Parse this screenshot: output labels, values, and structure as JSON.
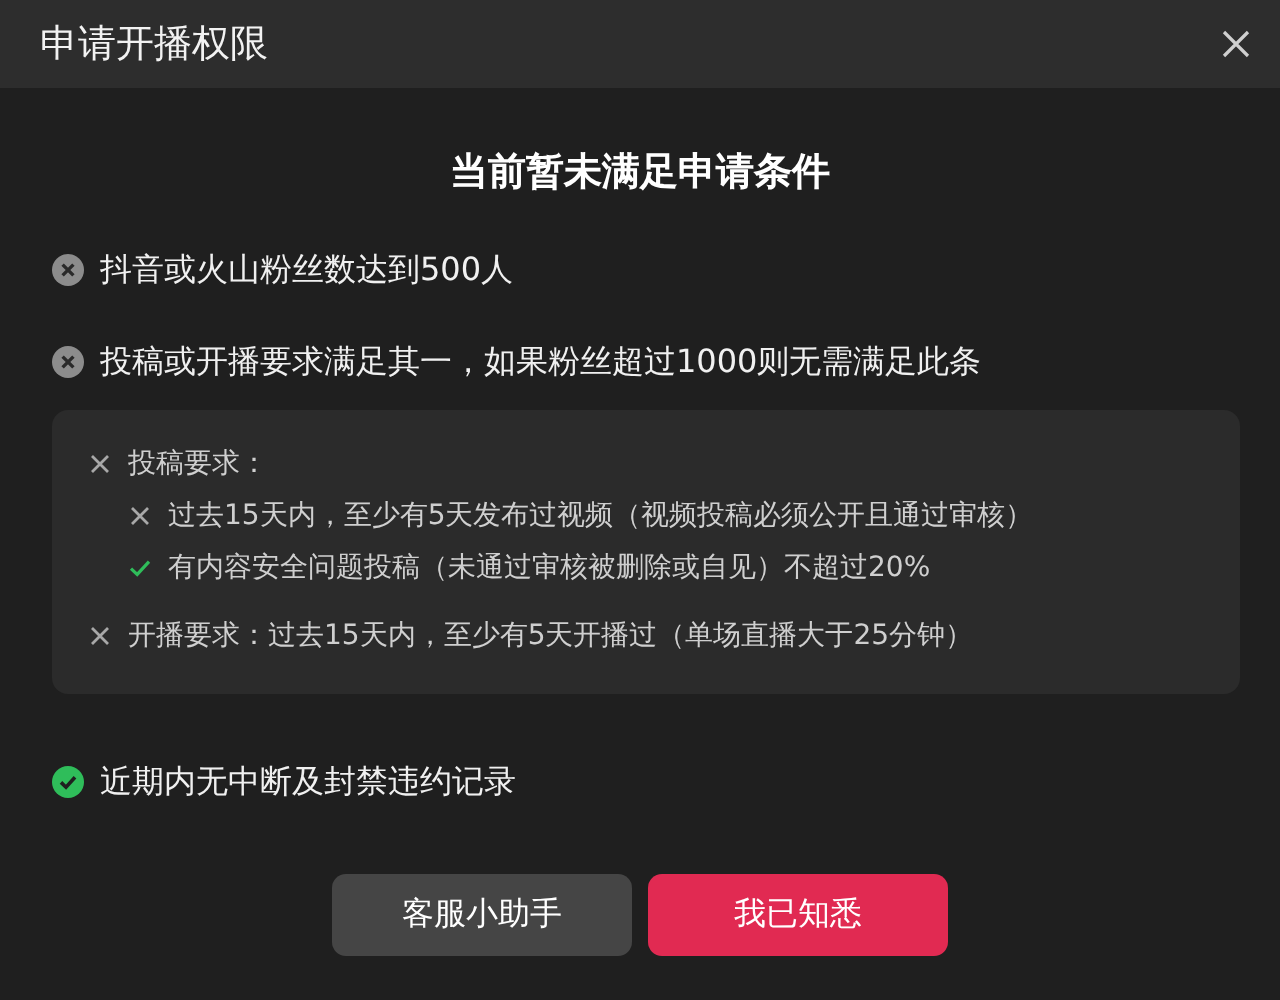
{
  "window": {
    "title": "申请开播权限"
  },
  "heading": "当前暂未满足申请条件",
  "conditions": [
    {
      "text": "抖音或火山粉丝数达到500人",
      "met": false
    },
    {
      "text": "投稿或开播要求满足其一，如果粉丝超过1000则无需满足此条",
      "met": false,
      "requirements": [
        {
          "text": "投稿要求：",
          "met": false,
          "children": [
            {
              "text": "过去15天内，至少有5天发布过视频（视频投稿必须公开且通过审核）",
              "met": false
            },
            {
              "text": "有内容安全问题投稿（未通过审核被删除或自见）不超过20%",
              "met": true
            }
          ]
        },
        {
          "text": "开播要求：过去15天内，至少有5天开播过（单场直播大于25分钟）",
          "met": false
        }
      ]
    },
    {
      "text": "近期内无中断及封禁违约记录",
      "met": true
    }
  ],
  "buttons": [
    {
      "label": "客服小助手",
      "kind": "secondary"
    },
    {
      "label": "我已知悉",
      "kind": "primary"
    }
  ]
}
